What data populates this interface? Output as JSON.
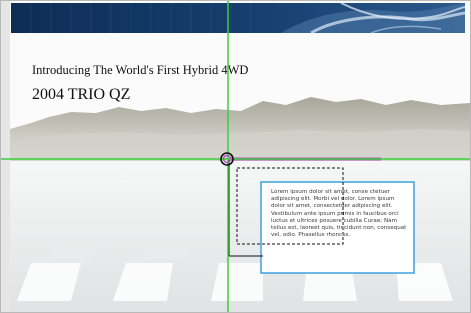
{
  "page": {
    "headline": "Introducing The World's First Hybrid 4WD",
    "model": "2004 TRIO QZ",
    "body_text": "Lorem ipsum dolor sit amet, conse ctetuer adipiscing elit. Morbi vel dolor. Lorem ipsum dolor sit amet, consectetuer adipiscing elit. Vestibulum ante ipsum primis in faucibus orci luctus et ultrices posuere cubilia Curae; Nam tellus est, laoreet quis, tincidunt non, consequat vel, odio. Phasellus rhoncus."
  },
  "colors": {
    "banner": "#10335f",
    "guide_line": "#3ad03a",
    "text_box_border": "#3aa3dc",
    "highlight_bar": "#b455c4"
  },
  "icons": [
    "crosshair-origin-icon"
  ]
}
